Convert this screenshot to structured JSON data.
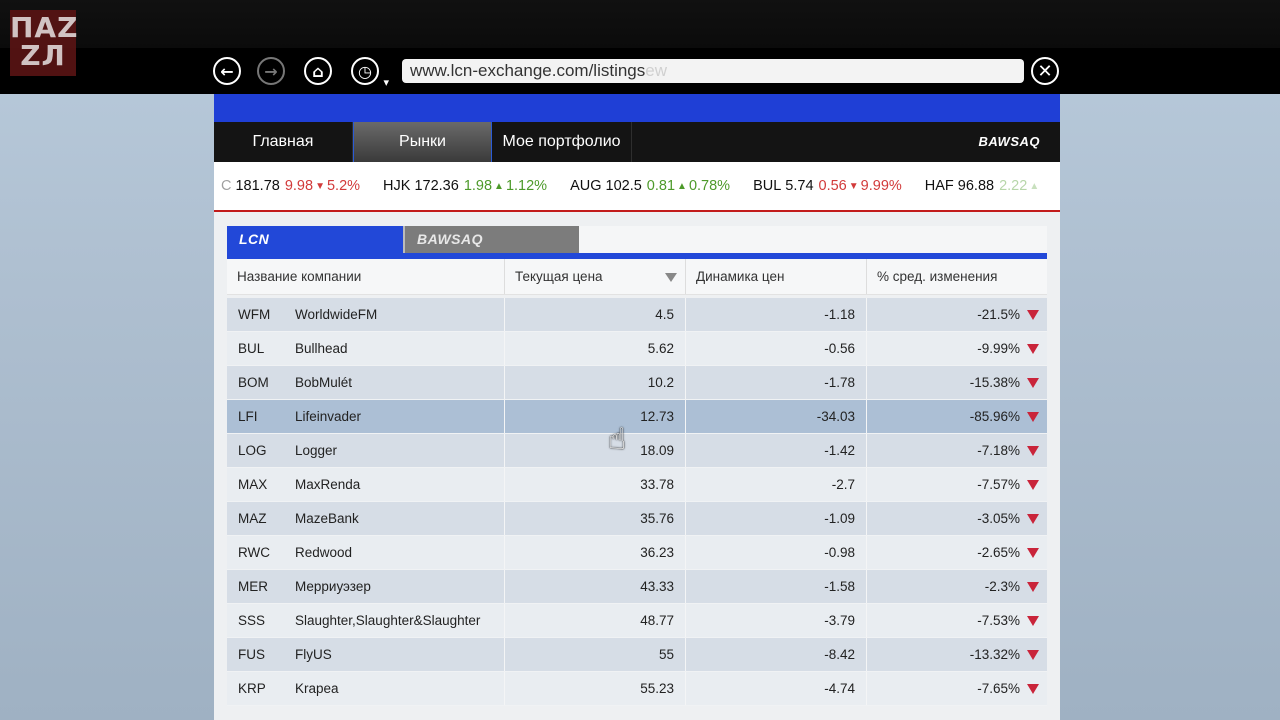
{
  "logo": {
    "line1": "ПАZ",
    "line2": "ZЛ"
  },
  "browser": {
    "url": "www.lcn-exchange.com/listings",
    "url_ghost": "ew"
  },
  "menu": {
    "items": [
      {
        "label": "Главная"
      },
      {
        "label": "Рынки"
      },
      {
        "label": "Мое портфолио"
      }
    ],
    "brand": "BAWSAQ"
  },
  "ticker": [
    {
      "symbol": "",
      "price": "181.78",
      "change": "9.98",
      "pct": "5.2%",
      "dir": "down",
      "prefix": "C"
    },
    {
      "symbol": "HJK",
      "price": "172.36",
      "change": "1.98",
      "pct": "1.12%",
      "dir": "up"
    },
    {
      "symbol": "AUG",
      "price": "102.5",
      "change": "0.81",
      "pct": "0.78%",
      "dir": "up"
    },
    {
      "symbol": "BUL",
      "price": "5.74",
      "change": "0.56",
      "pct": "9.99%",
      "dir": "down"
    },
    {
      "symbol": "HAF",
      "price": "96.88",
      "change": "2.22",
      "pct": "",
      "dir": "up"
    }
  ],
  "exchange_tabs": [
    {
      "label": "LCN",
      "active": true
    },
    {
      "label": "BAWSAQ",
      "active": false
    }
  ],
  "table": {
    "headers": [
      "Название компании",
      "Текущая цена",
      "Динамика цен",
      "% сред. изменения"
    ],
    "rows": [
      {
        "sym": "WFM",
        "name": "WorldwideFM",
        "price": "4.5",
        "delta": "-1.18",
        "pct": "-21.5%"
      },
      {
        "sym": "BUL",
        "name": "Bullhead",
        "price": "5.62",
        "delta": "-0.56",
        "pct": "-9.99%"
      },
      {
        "sym": "BOM",
        "name": "BobMulét",
        "price": "10.2",
        "delta": "-1.78",
        "pct": "-15.38%"
      },
      {
        "sym": "LFI",
        "name": "Lifeinvader",
        "price": "12.73",
        "delta": "-34.03",
        "pct": "-85.96%"
      },
      {
        "sym": "LOG",
        "name": "Logger",
        "price": "18.09",
        "delta": "-1.42",
        "pct": "-7.18%"
      },
      {
        "sym": "MAX",
        "name": "MaxRenda",
        "price": "33.78",
        "delta": "-2.7",
        "pct": "-7.57%"
      },
      {
        "sym": "MAZ",
        "name": "MazeBank",
        "price": "35.76",
        "delta": "-1.09",
        "pct": "-3.05%"
      },
      {
        "sym": "RWC",
        "name": "Redwood",
        "price": "36.23",
        "delta": "-0.98",
        "pct": "-2.65%"
      },
      {
        "sym": "MER",
        "name": "Мерриуэзер",
        "price": "43.33",
        "delta": "-1.58",
        "pct": "-2.3%"
      },
      {
        "sym": "SSS",
        "name": "Slaughter,Slaughter&Slaughter",
        "price": "48.77",
        "delta": "-3.79",
        "pct": "-7.53%"
      },
      {
        "sym": "FUS",
        "name": "FlyUS",
        "price": "55",
        "delta": "-8.42",
        "pct": "-13.32%"
      },
      {
        "sym": "KRP",
        "name": "Krapea",
        "price": "55.23",
        "delta": "-4.74",
        "pct": "-7.65%"
      }
    ]
  },
  "colors": {
    "accent": "#2248d8",
    "down": "#c9243a",
    "up": "#4d9a2a"
  }
}
